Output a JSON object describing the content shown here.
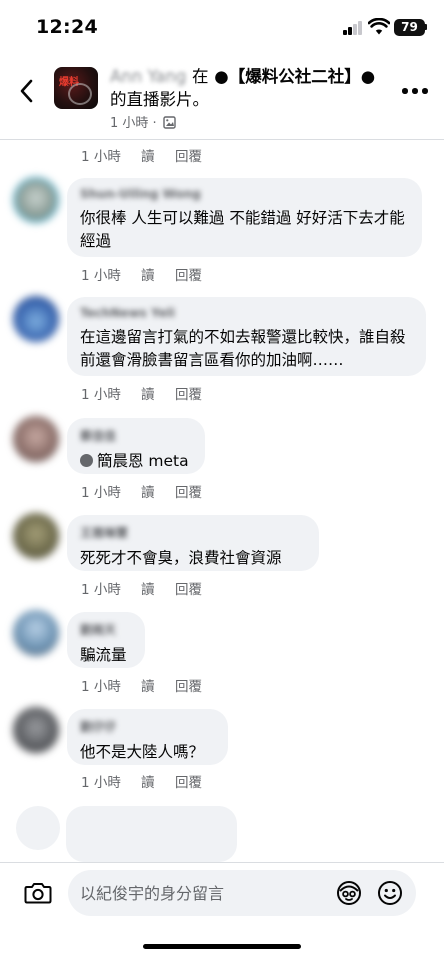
{
  "status": {
    "time": "12:24",
    "battery": "79"
  },
  "post": {
    "author": "Ann Yang",
    "in_word": "在",
    "page_name": "●【爆料公社二社】●",
    "suffix": "的直播影片。",
    "meta": "1 小時 ·",
    "avatar_text": "爆料"
  },
  "top_actions": {
    "time": "1 小時",
    "read": "讀",
    "reply": "回覆"
  },
  "comments": [
    {
      "author": "Shun-Uiling Wong",
      "text": "你很棒 人生可以難過 不能錯過 好好活下去才能經過",
      "time": "1 小時",
      "read": "讀",
      "reply": "回覆",
      "avatar_color": "#9aa7a3"
    },
    {
      "author": "TechNews Yeli",
      "text": "在這邊留言打氣的不如去報警還比較快，誰自殺前還會滑臉書留言區看你的加油啊……",
      "time": "1 小時",
      "read": "讀",
      "reply": "回覆",
      "avatar_color": "#3f6fb8"
    },
    {
      "author": "蔡佳佳",
      "tag_name": "簡晨恩 meta",
      "time": "1 小時",
      "read": "讀",
      "reply": "回覆",
      "avatar_color": "#8c6f6a"
    },
    {
      "author": "王雅琳慧",
      "text": "死死才不會臭，浪費社會資源",
      "time": "1 小時",
      "read": "讀",
      "reply": "回覆",
      "avatar_color": "#6e6b4c"
    },
    {
      "author": "劉雨天",
      "text": "騙流量",
      "time": "1 小時",
      "read": "讀",
      "reply": "回覆",
      "avatar_color": "#6d93b3"
    },
    {
      "author": "劉仔仔",
      "text": "他不是大陸人嗎？",
      "time": "1 小時",
      "read": "讀",
      "reply": "回覆",
      "avatar_color": "#5d5f63"
    }
  ],
  "composer": {
    "placeholder": "以紀俊宇的身分留言"
  }
}
